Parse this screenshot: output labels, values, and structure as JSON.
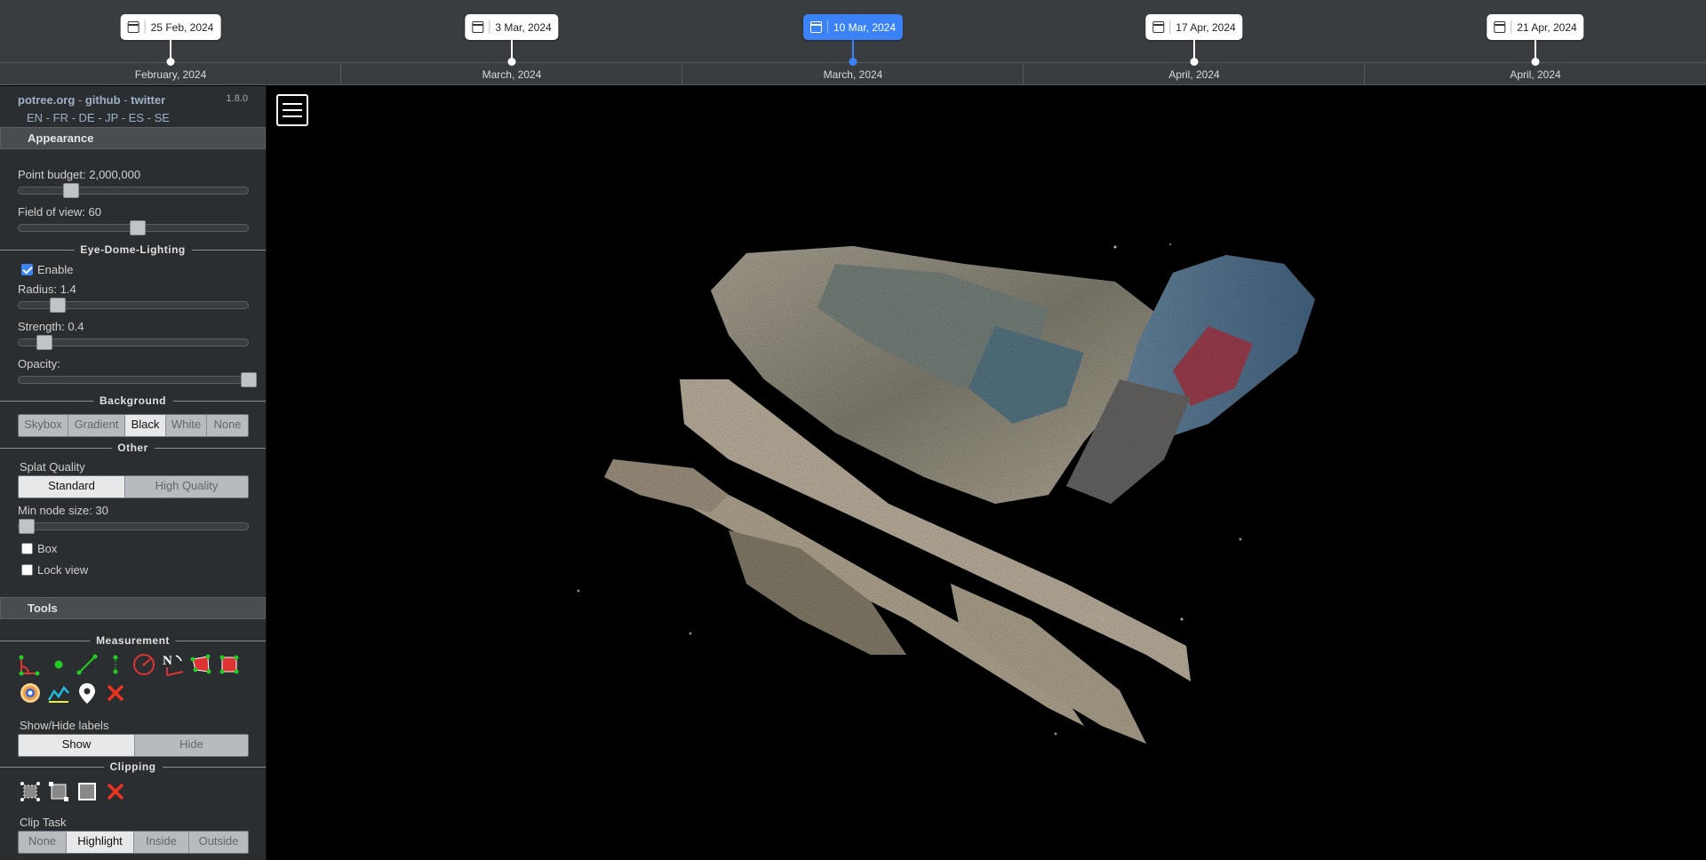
{
  "timeline": {
    "slots": [
      {
        "date": "25 Feb, 2024",
        "month": "February, 2024",
        "active": false
      },
      {
        "date": "3 Mar, 2024",
        "month": "March, 2024",
        "active": false
      },
      {
        "date": "10 Mar, 2024",
        "month": "March, 2024",
        "active": true
      },
      {
        "date": "17 Apr, 2024",
        "month": "April, 2024",
        "active": false
      },
      {
        "date": "21 Apr, 2024",
        "month": "April, 2024",
        "active": false
      }
    ]
  },
  "sidebar": {
    "links": {
      "potree": "potree.org",
      "github": "github",
      "twitter": "twitter",
      "sep": " - "
    },
    "version": "1.8.0",
    "languages": [
      "EN",
      "FR",
      "DE",
      "JP",
      "ES",
      "SE"
    ],
    "appearance": {
      "header": "Appearance",
      "point_budget_label": "Point budget: 2,000,000",
      "point_budget_value": 0.2,
      "fov_label": "Field of view: 60",
      "fov_value": 0.5,
      "edl": {
        "title": "Eye-Dome-Lighting",
        "enable_label": "Enable",
        "enabled": true,
        "radius_label": "Radius: 1.4",
        "radius_value": 0.14,
        "strength_label": "Strength: 0.4",
        "strength_value": 0.08,
        "opacity_label": "Opacity:",
        "opacity_value": 1.0
      },
      "background": {
        "title": "Background",
        "options": [
          "Skybox",
          "Gradient",
          "Black",
          "White",
          "None"
        ],
        "selected": "Black"
      },
      "other": {
        "title": "Other",
        "splat_quality_label": "Splat Quality",
        "splat_options": [
          "Standard",
          "High Quality"
        ],
        "splat_selected": "Standard",
        "min_node_label": "Min node size: 30",
        "min_node_value": 0.0,
        "box_label": "Box",
        "box_checked": false,
        "lock_view_label": "Lock view",
        "lock_view_checked": false
      }
    },
    "tools": {
      "header": "Tools",
      "measurement_title": "Measurement",
      "measurement_tools": [
        "angle-icon",
        "point-icon",
        "distance-icon",
        "height-icon",
        "circle-icon",
        "azimuth-icon",
        "area-icon",
        "volume-icon",
        "sphere-volume-icon",
        "profile-icon",
        "annotation-icon",
        "remove-all-measurements-icon"
      ],
      "labels_title": "Show/Hide labels",
      "labels_options": [
        "Show",
        "Hide"
      ],
      "labels_selected": "Show",
      "clipping_title": "Clipping",
      "clipping_tools": [
        "clip-polygon-icon",
        "clip-screen-box-icon",
        "clip-volume-icon",
        "remove-clipping-icon"
      ],
      "clip_task_label": "Clip Task",
      "clip_task_options": [
        "None",
        "Highlight",
        "Inside",
        "Outside"
      ],
      "clip_task_selected": "Highlight"
    }
  },
  "viewer": {
    "menu_icon": "hamburger-menu-icon",
    "content": "point-cloud-render"
  },
  "colors": {
    "accent": "#3b82f6",
    "panel_bg": "#2b2e30",
    "timeline_bg": "#3a3d40"
  }
}
